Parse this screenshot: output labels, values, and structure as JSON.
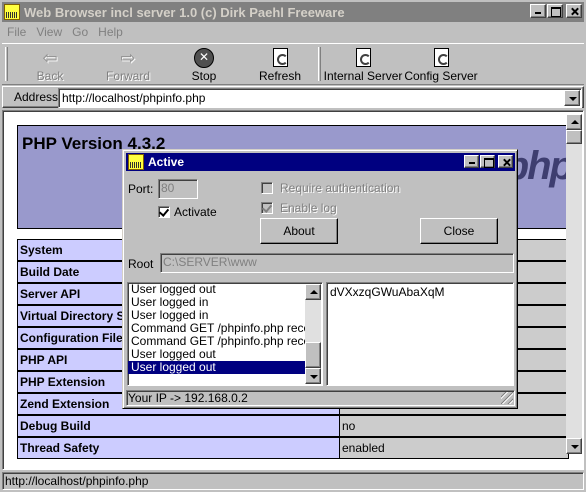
{
  "window": {
    "title": "Web Browser incl server 1.0 (c) Dirk Paehl Freeware"
  },
  "menu": [
    "File",
    "View",
    "Go",
    "Help"
  ],
  "toolbar": {
    "back": "Back",
    "forward": "Forward",
    "stop": "Stop",
    "refresh": "Refresh",
    "internal_server": "Internal Server",
    "config_server": "Config Server"
  },
  "address": {
    "label": "Address",
    "value": "http://localhost/phpinfo.php"
  },
  "page": {
    "title": "PHP Version 4.3.2",
    "logo": "php",
    "rows": [
      {
        "label": "System",
        "value": ""
      },
      {
        "label": "Build Date",
        "value": ""
      },
      {
        "label": "Server API",
        "value": ""
      },
      {
        "label": "Virtual Directory S",
        "value": ""
      },
      {
        "label": "Configuration File (",
        "value": ""
      },
      {
        "label": "PHP API",
        "value": ""
      },
      {
        "label": "PHP Extension",
        "value": ""
      },
      {
        "label": "Zend Extension",
        "value": ""
      },
      {
        "label": "Debug Build",
        "value": "no"
      },
      {
        "label": "Thread Safety",
        "value": "enabled"
      }
    ]
  },
  "status": {
    "text": "http://localhost/phpinfo.php"
  },
  "dialog": {
    "title": "Active",
    "port_label": "Port:",
    "port_value": "80",
    "activate_label": "Activate",
    "activate_checked": true,
    "require_auth_label": "Require authentication",
    "enable_log_label": "Enable log",
    "about_button": "About",
    "close_button": "Close",
    "root_label": "Root",
    "root_value": "C:\\SERVER\\www",
    "log": [
      "User logged out",
      "User logged in",
      "User logged in",
      "Command GET /phpinfo.php received",
      "Command GET /phpinfo.php received",
      "User logged out",
      "User logged out"
    ],
    "selected_log_index": 6,
    "token": "dVXxzqGWuAbaXqM",
    "status": "Your IP -> 192.168.0.2"
  }
}
